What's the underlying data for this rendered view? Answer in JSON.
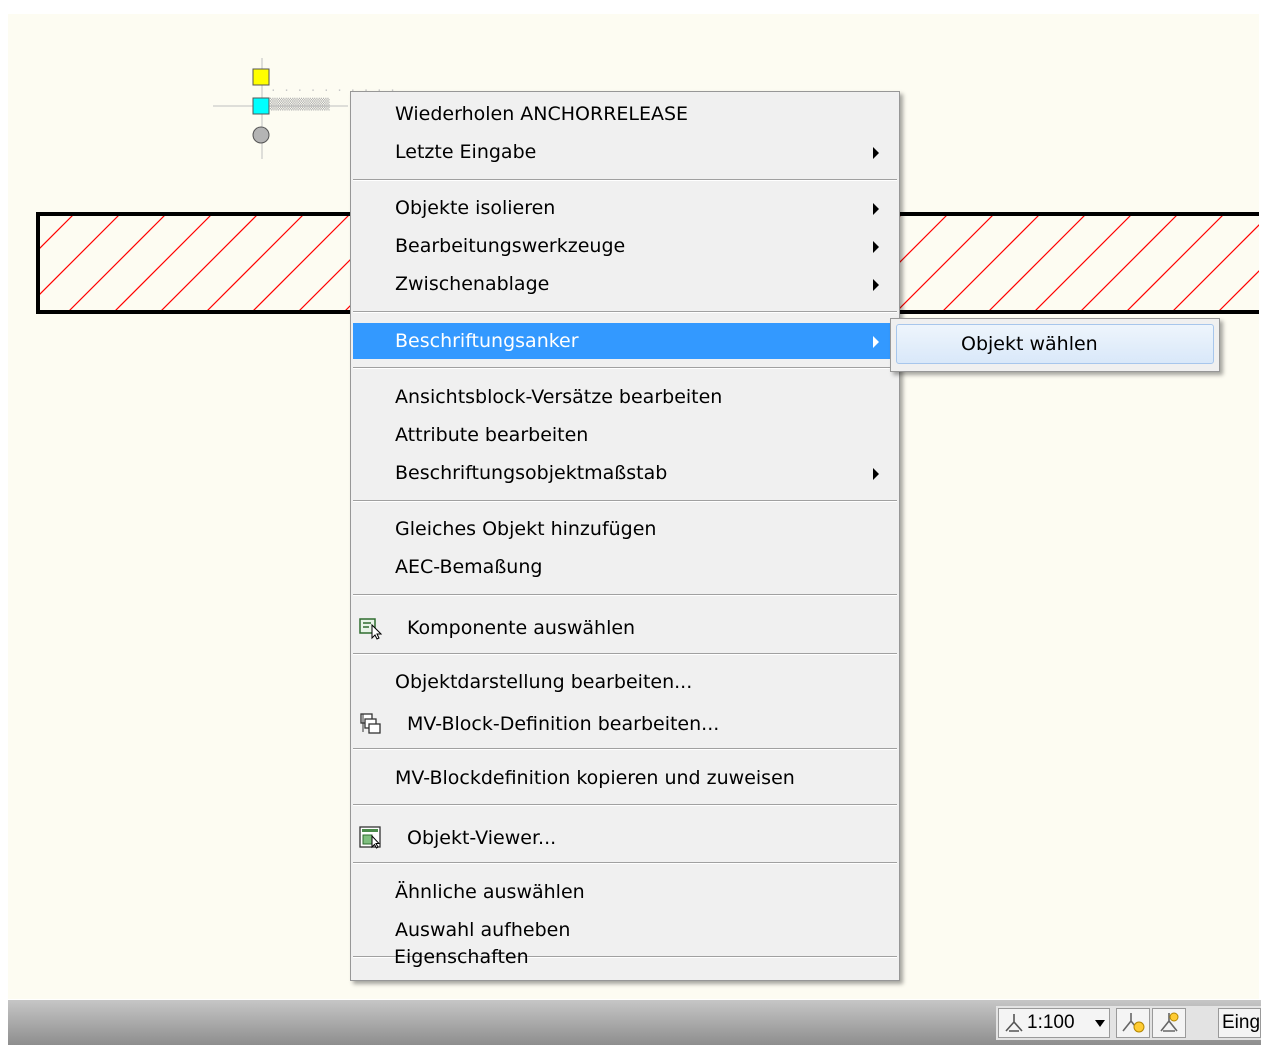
{
  "menu": {
    "items": [
      {
        "label": "Wiederholen ANCHORRELEASE",
        "submenu": false
      },
      {
        "label": "Letzte Eingabe",
        "submenu": true
      },
      {
        "label": "Objekte isolieren",
        "submenu": true
      },
      {
        "label": "Bearbeitungswerkzeuge",
        "submenu": true
      },
      {
        "label": "Zwischenablage",
        "submenu": true
      },
      {
        "label": "Beschriftungsanker",
        "submenu": true,
        "highlighted": true
      },
      {
        "label": "Ansichtsblock-Versätze bearbeiten",
        "submenu": false
      },
      {
        "label": "Attribute bearbeiten",
        "submenu": false
      },
      {
        "label": "Beschriftungsobjektmaßstab",
        "submenu": true
      },
      {
        "label": "Gleiches Objekt hinzufügen",
        "submenu": false
      },
      {
        "label": "AEC-Bemaßung",
        "submenu": false
      },
      {
        "label": "Komponente auswählen",
        "submenu": false,
        "icon": "select-component-icon"
      },
      {
        "label": "Objektdarstellung bearbeiten...",
        "submenu": false
      },
      {
        "label": "MV-Block-Definition bearbeiten...",
        "submenu": false,
        "icon": "mv-block-icon"
      },
      {
        "label": "MV-Blockdefinition kopieren und zuweisen",
        "submenu": false
      },
      {
        "label": "Objekt-Viewer...",
        "submenu": false,
        "icon": "object-viewer-icon"
      },
      {
        "label": "Ähnliche auswählen",
        "submenu": false
      },
      {
        "label": "Auswahl aufheben",
        "submenu": false
      },
      {
        "label": "Eigenschaften",
        "submenu": false
      }
    ]
  },
  "submenu": {
    "label": "Objekt wählen"
  },
  "status_bar": {
    "scale": "1:100",
    "scale_dropdown_icon": "chevron-down-icon",
    "annotation_icons": [
      "annotation-visibility-icon",
      "annotation-autoscale-icon"
    ],
    "input_label": "Eing"
  },
  "colors": {
    "highlight": "#3399ff",
    "hatch": "#ff0000",
    "grip_yellow": "#ffff00",
    "grip_cyan": "#00ffff"
  }
}
